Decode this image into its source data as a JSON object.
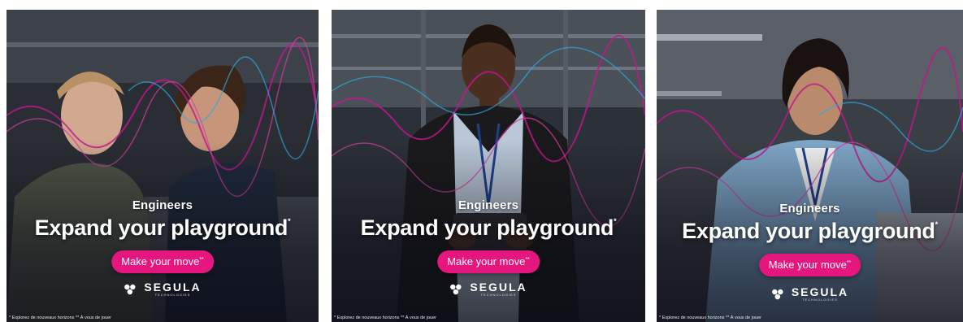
{
  "panels": [
    {
      "kicker": "Engineers",
      "headline": "Expand your playground",
      "headline_mark": "*",
      "cta": "Make your move",
      "cta_mark": "**",
      "brand": "SEGULA",
      "brand_sub": "TECHNOLOGIES",
      "disclaimer": "* Explorez de nouveaux horizons ** À vous de jouer"
    },
    {
      "kicker": "Engineers",
      "headline": "Expand your playground",
      "headline_mark": "*",
      "cta": "Make your move",
      "cta_mark": "**",
      "brand": "SEGULA",
      "brand_sub": "TECHNOLOGIES",
      "disclaimer": "* Explorez de nouveaux horizons ** À vous de jouer"
    },
    {
      "kicker": "Engineers",
      "headline": "Expand your playground",
      "headline_mark": "*",
      "cta": "Make your move",
      "cta_mark": "**",
      "brand": "SEGULA",
      "brand_sub": "TECHNOLOGIES",
      "disclaimer": "* Explorez de nouveaux horizons ** À vous de jouer"
    }
  ],
  "colors": {
    "cta_background": "#e5177e",
    "wave_magenta": "#c2178f",
    "wave_cyan": "#2fa8d8",
    "text": "#ffffff"
  }
}
